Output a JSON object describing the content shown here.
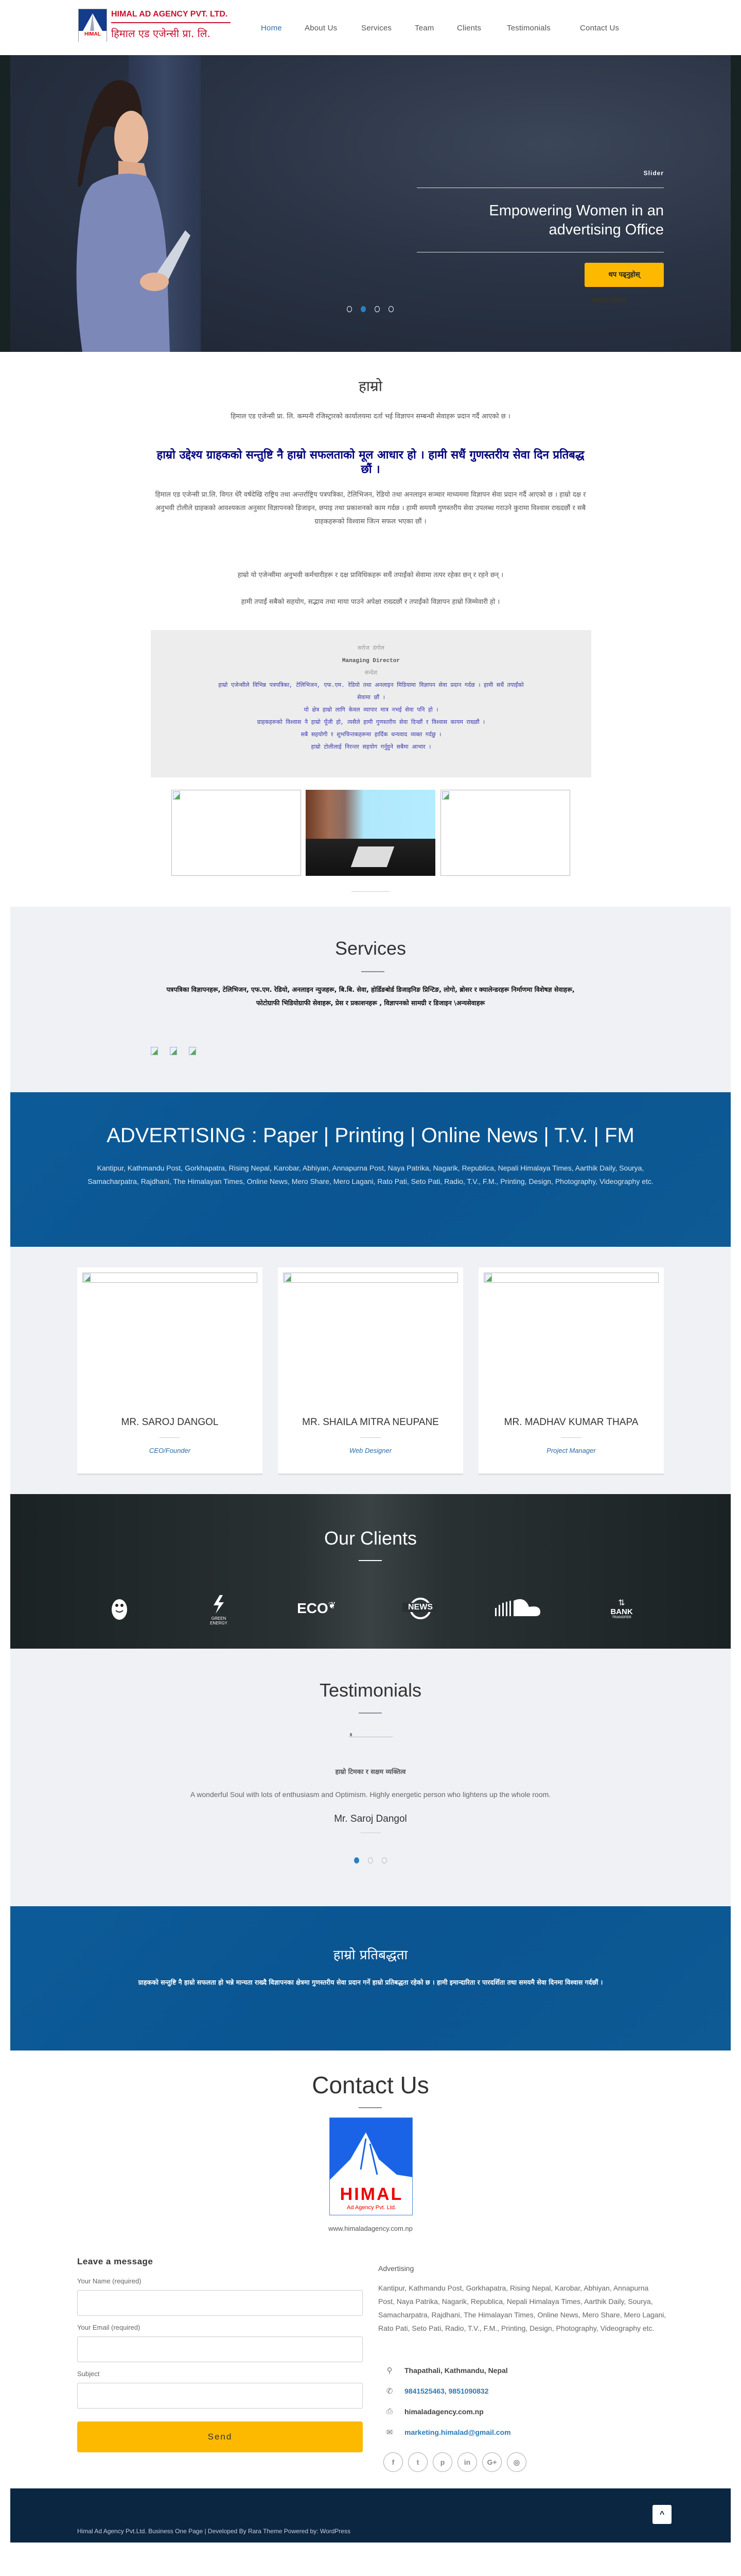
{
  "header": {
    "logo_en": "HIMAL AD AGENCY PVT. LTD.",
    "logo_np": "हिमाल एड एजेन्सी प्रा. लि.",
    "logo_mark": "HIMAL",
    "logo_mark_sub": "Ad Agency Pvt. Ltd.",
    "nav": [
      "Home",
      "About Us",
      "Services",
      "Team",
      "Clients",
      "Testimonials",
      "Contact Us"
    ]
  },
  "hero": {
    "label": "Slider",
    "heading_line1": "Empowering Women in an",
    "heading_line2": "advertising Office",
    "button": "थप पढ्नुहोस्",
    "hidden_text": "स्लाइडर विवरण",
    "active_dot": 2,
    "dots": 4
  },
  "about": {
    "title": "हाम्रो",
    "intro": "हिमाल एड एजेन्सी प्रा. लि. कम्पनी रजिस्ट्रारको कार्यालयमा दर्ता भई विज्ञापन सम्बन्धी सेवाहरू प्रदान गर्दै आएको छ ।",
    "highlight": "हाम्रो उद्देश्य ग्राहकको सन्तुष्टि नै हाम्रो सफलताको मूल आधार हो । हामी सधैं गुणस्तरीय सेवा दिन प्रतिबद्ध छौं ।",
    "body1": "हिमाल एड एजेन्सी प्रा.लि. विगत धेरै वर्षदेखि राष्ट्रिय तथा अन्तर्राष्ट्रिय पत्रपत्रिका, टेलिभिजन, रेडियो तथा अनलाइन सञ्चार माध्यममा विज्ञापन सेवा प्रदान गर्दै आएको छ । हाम्रो दक्ष र अनुभवी टोलीले ग्राहकको आवश्यकता अनुसार विज्ञापनको डिजाइन, छपाइ तथा प्रकाशनको काम गर्दछ । हामी समयमै गुणस्तरीय सेवा उपलब्ध गराउने कुरामा विश्वास राख्दछौं र सबै ग्राहकहरूको विश्वास जित्न सफल भएका छौं ।",
    "body2": "हाम्रो यो एजेन्सीमा अनुभवी कर्मचारीहरू र दक्ष प्राविधिकहरू सधैं तपाईंको सेवामा तत्पर रहेका छन् र रहने छन् ।",
    "body3": "हामी तपाईं सबैको सहयोग, सद्भाव तथा माया पाउने अपेक्षा राख्दछौं र तपाईंको विज्ञापन हाम्रो जिम्मेवारी हो ।",
    "director": {
      "name": "सरोज डंगोल",
      "title": "Managing Director",
      "label": "सन्देश",
      "lines": [
        "हाम्रो एजेन्सीले विभिन्न पत्रपत्रिका, टेलिभिजन, एफ.एम. रेडियो तथा अनलाइन मिडियामा विज्ञापन सेवा प्रदान गर्दछ । हामी सधैं तपाईंको",
        "सेवामा छौं ।",
        "यो क्षेत्र हाम्रो लागि केवल व्यापार मात्र नभई सेवा पनि हो ।",
        "ग्राहकहरूको विश्वास नै हाम्रो पूँजी हो, त्यसैले हामी गुणस्तरीय सेवा दिन्छौं र विश्वास कायम राख्छौं ।",
        "सबै सहयोगी र शुभचिन्तकहरूमा हार्दिक धन्यवाद व्यक्त गर्दछु ।",
        "हाम्रो टोलीलाई निरन्तर सहयोग गर्नुहुने सबैमा आभार ।"
      ]
    }
  },
  "services": {
    "title": "Services",
    "text": "पत्रपत्रिका विज्ञापनहरू, टेलिभिजन, एफ.एम. रेडियो, अनलाइन न्युजहरू, बि.बि. सेवा, होर्डिङबोर्ड डिजाइनिङ प्रिन्टिङ, लोगो, ब्रोसर र क्यालेन्डरहरू निर्माणमा विशेषज्ञ सेवाहरू, फोटोग्राफी भिडियोग्राफी सेवाहरू, प्रेस र प्रकाशनहरू , विज्ञापनको सामग्री र डिजाइन \\अन्यसेवाहरू"
  },
  "advertising": {
    "heading": "ADVERTISING : Paper | Printing | Online News | T.V. | FM",
    "text": "Kantipur, Kathmandu Post, Gorkhapatra, Rising Nepal, Karobar, Abhiyan, Annapurna Post, Naya Patrika, Nagarik, Republica, Nepali Himalaya Times, Aarthik Daily, Sourya, Samacharpatra, Rajdhani, The Himalayan Times, Online News, Mero Share, Mero Lagani, Rato Pati, Seto Pati, Radio, T.V., F.M., Printing, Design, Photography, Videography etc."
  },
  "team": [
    {
      "name": "MR. SAROJ DANGOL",
      "role": "CEO/Founder"
    },
    {
      "name": "MR. SHAILA MITRA NEUPANE",
      "role": "Web Designer"
    },
    {
      "name": "MR. MADHAV KUMAR THAPA",
      "role": "Project Manager"
    }
  ],
  "clients": {
    "title": "Our Clients",
    "logos": [
      {
        "icon": "penguin-icon",
        "text": ""
      },
      {
        "icon": "lightning-icon",
        "text": "GREEN ENERGY"
      },
      {
        "icon": "leaf-icon",
        "text": "ECO"
      },
      {
        "icon": "globe-icon",
        "text": "NEWS"
      },
      {
        "icon": "soundcloud-icon",
        "text": ""
      },
      {
        "icon": "bank-icon",
        "text": "BANK",
        "sub": "TRANSFER"
      }
    ]
  },
  "testimonials": {
    "title": "Testimonials",
    "heading": "हाम्रो टिमका र सक्षम व्यक्तित्व",
    "quote": "A wonderful Soul with lots of enthusiasm and Optimism. Highly energetic person who lightens up the whole room.",
    "name": "Mr. Saroj Dangol",
    "active_dot": 1,
    "dots": 3
  },
  "cta": {
    "heading": "हाम्रो प्रतिबद्धता",
    "text": "ग्राहकको सन्तुष्टि नै हाम्रो सफलता हो भन्ने मान्यता राख्दै विज्ञापनका क्षेत्रमा गुणस्तरीय सेवा प्रदान गर्ने हाम्रो प्रतिबद्धता रहेको छ । हामी इमान्दारिता र पारदर्शिता तथा समयमै सेवा दिनमा विश्वास गर्दछौं ।"
  },
  "contact": {
    "title": "Contact Us",
    "logo_text": "HIMAL",
    "logo_sub": "Ad Agency Pvt. Ltd.",
    "website": "www.himaladagency.com.np",
    "form": {
      "heading": "Leave a message",
      "name_label": "Your Name (required)",
      "email_label": "Your Email (required)",
      "subject_label": "Subject",
      "name_value": "",
      "email_value": "",
      "subject_value": "",
      "send": "Send"
    },
    "info": {
      "title": "Advertising",
      "text": "Kantipur, Kathmandu Post, Gorkhapatra, Rising Nepal, Karobar, Abhiyan, Annapurna Post, Naya Patrika, Nagarik, Republica, Nepali Himalaya Times, Aarthik Daily, Sourya, Samacharpatra, Rajdhani, The Himalayan Times, Online News, Mero Share, Mero Lagani, Rato Pati, Seto Pati, Radio, T.V., F.M., Printing, Design, Photography, Videography etc.",
      "address": "Thapathali, Kathmandu, Nepal",
      "phone": "9841525463, 9851090832",
      "fax": "himaladagency.com.np",
      "email": "marketing.himalad@gmail.com"
    },
    "social": [
      "facebook",
      "twitter",
      "pinterest",
      "linkedin",
      "google-plus",
      "instagram"
    ]
  },
  "footer": {
    "text": "Himal Ad Agency Pvt.Ltd. Business One Page | Developed By Rara Theme Powered by: WordPress"
  },
  "colors": {
    "accent": "#2a6fa8",
    "yellow": "#fdb900",
    "blue_band": "#0b5a96",
    "footer": "#0a2640",
    "grey_bg": "#f0f1f5"
  }
}
